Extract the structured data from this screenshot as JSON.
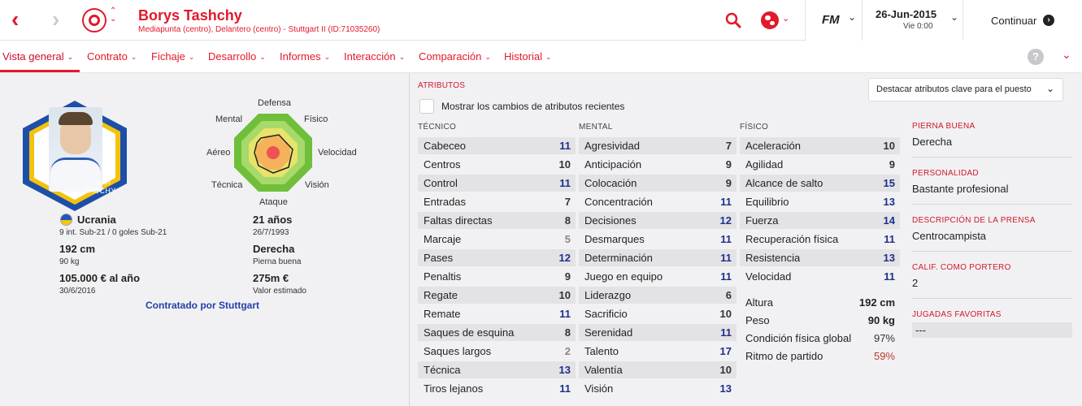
{
  "header": {
    "player_name": "Borys Tashchy",
    "player_subtitle": "Mediapunta (centro), Delantero (centro) - Stuttgart II (ID:71035260)",
    "fm_label": "FM",
    "date": "26-Jun-2015",
    "day_time": "Vie 0:00",
    "continue_label": "Continuar"
  },
  "menu": {
    "items": [
      {
        "label": "Vista general"
      },
      {
        "label": "Contrato"
      },
      {
        "label": "Fichaje"
      },
      {
        "label": "Desarrollo"
      },
      {
        "label": "Informes"
      },
      {
        "label": "Interacción"
      },
      {
        "label": "Comparación"
      },
      {
        "label": "Historial"
      }
    ],
    "help_label": "?"
  },
  "profile": {
    "shirt_first": "Borys",
    "shirt_last": "TASCHY",
    "nationality": "Ucrania",
    "intl_caps": "9 int. Sub-21 / 0 goles Sub-21",
    "age": "21 años",
    "dob": "26/7/1993",
    "height": "192 cm",
    "weight": "90 kg",
    "foot": "Derecha",
    "foot_label": "Pierna buena",
    "wage": "105.000 € al año",
    "contract_end": "30/6/2016",
    "value": "275m €",
    "value_label": "Valor estimado",
    "contracted_by": "Contratado por Stuttgart"
  },
  "radar": {
    "labels": {
      "defensa": "Defensa",
      "fisico": "Físico",
      "velocidad": "Velocidad",
      "vision": "Visión",
      "ataque": "Ataque",
      "tecnica": "Técnica",
      "aereo": "Aéreo",
      "mental": "Mental"
    }
  },
  "attributes": {
    "title": "ATRIBUTOS",
    "highlight_dropdown": "Destacar atributos clave para el puesto",
    "show_changes_label": "Mostrar los cambios de atributos recientes",
    "tecnico_header": "TÉCNICO",
    "mental_header": "MENTAL",
    "fisico_header": "FÍSICO",
    "tecnico": [
      {
        "name": "Cabeceo",
        "value": "11"
      },
      {
        "name": "Centros",
        "value": "10"
      },
      {
        "name": "Control",
        "value": "11"
      },
      {
        "name": "Entradas",
        "value": "7"
      },
      {
        "name": "Faltas directas",
        "value": "8"
      },
      {
        "name": "Marcaje",
        "value": "5"
      },
      {
        "name": "Pases",
        "value": "12"
      },
      {
        "name": "Penaltis",
        "value": "9"
      },
      {
        "name": "Regate",
        "value": "10"
      },
      {
        "name": "Remate",
        "value": "11"
      },
      {
        "name": "Saques de esquina",
        "value": "8"
      },
      {
        "name": "Saques largos",
        "value": "2"
      },
      {
        "name": "Técnica",
        "value": "13"
      },
      {
        "name": "Tiros lejanos",
        "value": "11"
      }
    ],
    "mental": [
      {
        "name": "Agresividad",
        "value": "7"
      },
      {
        "name": "Anticipación",
        "value": "9"
      },
      {
        "name": "Colocación",
        "value": "9"
      },
      {
        "name": "Concentración",
        "value": "11"
      },
      {
        "name": "Decisiones",
        "value": "12"
      },
      {
        "name": "Desmarques",
        "value": "11"
      },
      {
        "name": "Determinación",
        "value": "11"
      },
      {
        "name": "Juego en equipo",
        "value": "11"
      },
      {
        "name": "Liderazgo",
        "value": "6"
      },
      {
        "name": "Sacrificio",
        "value": "10"
      },
      {
        "name": "Serenidad",
        "value": "11"
      },
      {
        "name": "Talento",
        "value": "17"
      },
      {
        "name": "Valentía",
        "value": "10"
      },
      {
        "name": "Visión",
        "value": "13"
      }
    ],
    "fisico": [
      {
        "name": "Aceleración",
        "value": "10"
      },
      {
        "name": "Agilidad",
        "value": "9"
      },
      {
        "name": "Alcance de salto",
        "value": "15"
      },
      {
        "name": "Equilibrio",
        "value": "13"
      },
      {
        "name": "Fuerza",
        "value": "14"
      },
      {
        "name": "Recuperación física",
        "value": "11"
      },
      {
        "name": "Resistencia",
        "value": "13"
      },
      {
        "name": "Velocidad",
        "value": "11"
      }
    ],
    "extra": [
      {
        "name": "Altura",
        "value": "192 cm"
      },
      {
        "name": "Peso",
        "value": "90 kg"
      },
      {
        "name": "Condición física global",
        "value": "97%"
      },
      {
        "name": "Ritmo de partido",
        "value": "59%"
      }
    ]
  },
  "sidebar": {
    "items": [
      {
        "label": "PIERNA BUENA",
        "value": "Derecha"
      },
      {
        "label": "PERSONALIDAD",
        "value": "Bastante profesional"
      },
      {
        "label": "DESCRIPCIÓN DE LA PRENSA",
        "value": "Centrocampista"
      },
      {
        "label": "CALIF. COMO PORTERO",
        "value": "2"
      },
      {
        "label": "JUGADAS FAVORITAS",
        "value": "---"
      }
    ]
  },
  "colors": {
    "accent": "#e2192c",
    "high_value": "#1e2f8a"
  }
}
